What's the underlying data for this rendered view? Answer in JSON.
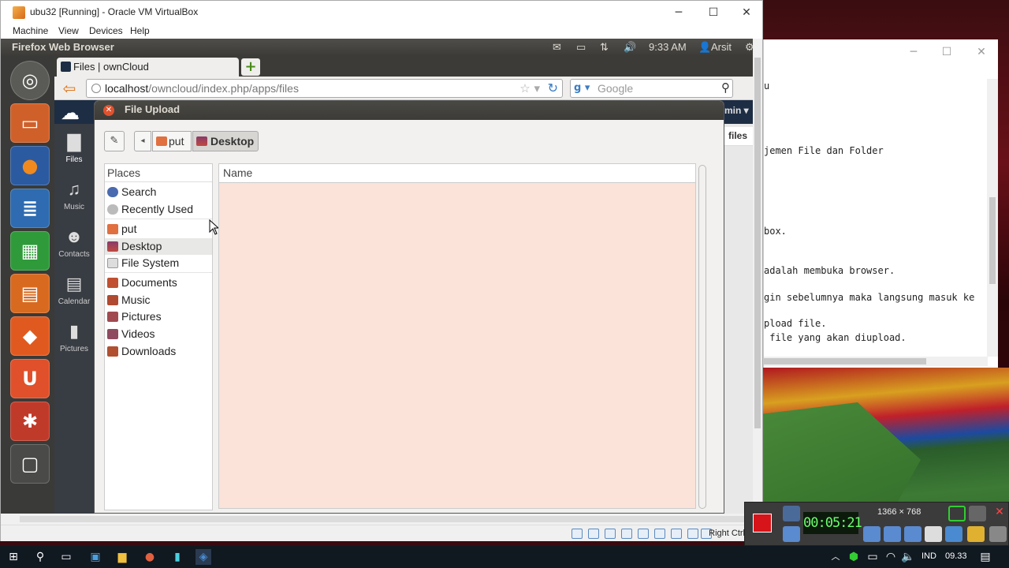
{
  "vbox": {
    "title": "ubu32 [Running] - Oracle VM VirtualBox",
    "menu": [
      "Machine",
      "View",
      "Devices",
      "Help"
    ],
    "status_right": "Right Ctrl"
  },
  "ubuntu_panel": {
    "app_name": "Firefox Web Browser",
    "time": "9:33 AM",
    "user": "Arsit"
  },
  "firefox": {
    "tab_title": "Files | ownCloud",
    "url_host": "localhost",
    "url_path": "/owncloud/index.php/apps/files",
    "search_placeholder": "Google"
  },
  "owncloud": {
    "nav": [
      {
        "label": "Files",
        "icon": "folder-icon"
      },
      {
        "label": "Music",
        "icon": "music-icon"
      },
      {
        "label": "Contacts",
        "icon": "contacts-icon"
      },
      {
        "label": "Calendar",
        "icon": "calendar-icon"
      },
      {
        "label": "Pictures",
        "icon": "pictures-icon"
      }
    ],
    "admin_label": "min ▾",
    "files_tab": "files"
  },
  "dialog": {
    "title": "File Upload",
    "breadcrumbs": [
      "put",
      "Desktop"
    ],
    "places_header": "Places",
    "places": [
      {
        "label": "Search",
        "icon": "search-icon"
      },
      {
        "label": "Recently Used",
        "icon": "recent-icon"
      },
      {
        "label": "put",
        "icon": "home-folder-icon"
      },
      {
        "label": "Desktop",
        "icon": "desktop-icon"
      },
      {
        "label": "File System",
        "icon": "drive-icon"
      },
      {
        "label": "Documents",
        "icon": "documents-folder-icon"
      },
      {
        "label": "Music",
        "icon": "music-folder-icon"
      },
      {
        "label": "Pictures",
        "icon": "pictures-folder-icon"
      },
      {
        "label": "Videos",
        "icon": "videos-folder-icon"
      },
      {
        "label": "Downloads",
        "icon": "downloads-folder-icon"
      }
    ],
    "selected_place": "Desktop",
    "column_header": "Name"
  },
  "bg_window": {
    "lines": [
      "u",
      "jemen File dan Folder",
      "box.",
      "adalah membuka browser.",
      "gin sebelumnya maka langsung masuk ke",
      "pload file.",
      " file yang akan diupload."
    ]
  },
  "recorder": {
    "timer": "00:05:21",
    "resolution": "1366 × 768"
  },
  "taskbar": {
    "language": "IND",
    "time": "09.33"
  }
}
